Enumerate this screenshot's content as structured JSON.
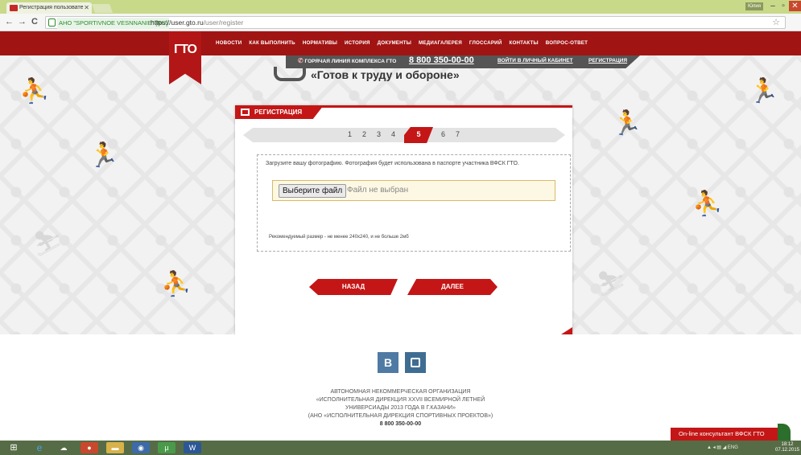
{
  "browser": {
    "tab_title": "Регистрация пользовате",
    "tab_close": "✕",
    "user_badge": "Юлия",
    "cert_label": "АНО \"SPORTIVNOE VESNNANIE\" [RU]",
    "url_host": "https://user.gto.ru",
    "url_path": "/user/register",
    "back": "←",
    "forward": "→",
    "reload": "C",
    "star": "☆",
    "min": "–",
    "max": "▫",
    "close": "✕"
  },
  "site": {
    "logo": "ГТО",
    "nav": [
      "НОВОСТИ",
      "КАК ВЫПОЛНИТЬ",
      "НОРМАТИВЫ",
      "ИСТОРИЯ",
      "ДОКУМЕНТЫ",
      "МЕДИАГАЛЕРЕЯ",
      "ГЛОССАРИЙ",
      "КОНТАКТЫ",
      "ВОПРОС-ОТВЕТ"
    ],
    "hotline_label": "ГОРЯЧАЯ ЛИНИЯ КОМПЛЕКСА ГТО",
    "hotline_number": "8 800 350-00-00",
    "cabinet_link": "ВОЙТИ В ЛИЧНЫЙ КАБИНЕТ",
    "register_link": "РЕГИСТРАЦИЯ",
    "slogan": "«Готов к труду и обороне»"
  },
  "registration": {
    "title": "РЕГИСТРАЦИЯ",
    "steps": [
      "1",
      "2",
      "3",
      "4",
      "5",
      "6",
      "7"
    ],
    "active_step": "5",
    "instruction": "Загрузите вашу фотографию. Фотография будет использована в паспорте участника ВФСК ГТО.",
    "file_button": "Выберите файл",
    "file_status": "Файл не выбран",
    "size_hint": "Рекомендуемый размер - не менее 240x240, и не больше 2мб",
    "back_button": "НАЗАД",
    "next_button": "ДАЛЕЕ"
  },
  "footer": {
    "vk": "B",
    "org_lines": [
      "АВТОНОМНАЯ НЕКОММЕРЧЕСКАЯ ОРГАНИЗАЦИЯ",
      "«ИСПОЛНИТЕЛЬНАЯ ДИРЕКЦИЯ XXVII ВСЕМИРНОЙ ЛЕТНЕЙ",
      "УНИВЕРСИАДЫ 2013 ГОДА В Г.КАЗАНИ»",
      "(АНО «ИСПОЛНИТЕЛЬНАЯ ДИРЕКЦИЯ СПОРТИВНЫХ ПРОЕКТОВ»)"
    ],
    "phone": "8 800 350-00-00",
    "consultant": "On-line консультант ВФСК ГТО"
  },
  "taskbar": {
    "lang": "ENG",
    "time": "18:12",
    "date": "07.12.2015"
  },
  "colors": {
    "brand_red": "#c41616",
    "nav_red": "#a11414",
    "taskbar": "#566c46"
  }
}
